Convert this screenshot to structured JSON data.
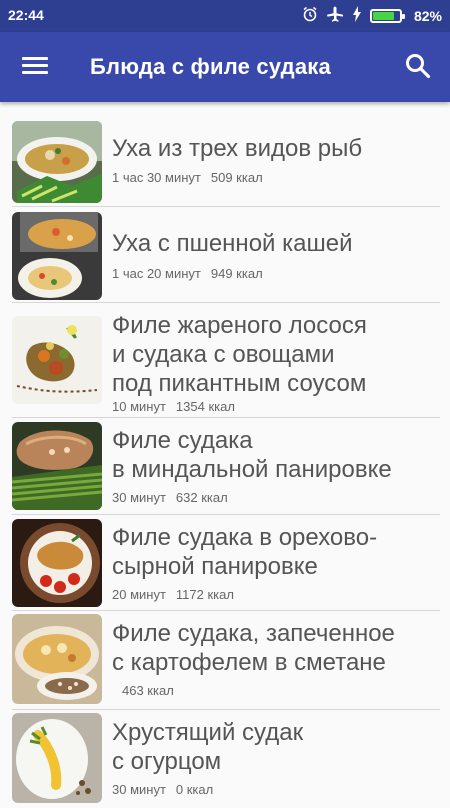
{
  "status_bar": {
    "time": "22:44",
    "battery_percent": "82%",
    "battery_level": 0.82
  },
  "app_bar": {
    "title": "Блюда с филе судака",
    "menu_icon": "menu-icon",
    "search_icon": "search-icon"
  },
  "recipes": [
    {
      "lines": [
        "Уха из трех видов рыб"
      ],
      "time": "1 час 30 минут",
      "calories": "509 ккал"
    },
    {
      "lines": [
        "Уха с пшенной кашей"
      ],
      "time": "1 час 20 минут",
      "calories": "949 ккал"
    },
    {
      "lines": [
        "Филе жареного лосося",
        "и судака с овощами",
        "под пикантным соусом"
      ],
      "time": "10 минут",
      "calories": "1354 ккал"
    },
    {
      "lines": [
        "Филе судака",
        "в миндальной панировке"
      ],
      "time": "30 минут",
      "calories": "632 ккал"
    },
    {
      "lines": [
        "Филе судака в орехово-",
        "сырной панировке"
      ],
      "time": "20 минут",
      "calories": "1172 ккал"
    },
    {
      "lines": [
        "Филе судака, запеченное",
        "с картофелем в сметане"
      ],
      "time": "",
      "calories": "463 ккал"
    },
    {
      "lines": [
        "Хрустящий судак",
        "с огурцом"
      ],
      "time": "30 минут",
      "calories": "0 ккал"
    }
  ]
}
